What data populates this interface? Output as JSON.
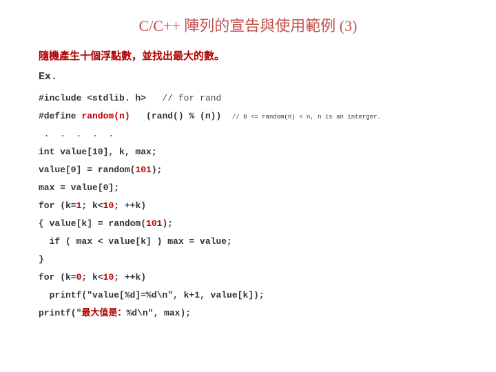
{
  "title": "C/C++ 陣列的宣告與使用範例 (3)",
  "subtitle": "隨機產生十個浮點數，並找出最大的數。",
  "ex_label": "Ex.",
  "code": {
    "l1a": "#include <stdlib. h>",
    "l1b": "// for rand",
    "l2a": "#define",
    "l2b": "random(n)",
    "l2c": "(rand() % (n))",
    "l2d": "// 0 <= random(n) < n, n is an interger.",
    "l3": " .  .  .  .  .",
    "l4": "int value[10], k, max;",
    "l5a": "value[0] = random(",
    "l5b": "101",
    "l5c": ");",
    "l6": "max = value[0];",
    "l7a": "for (k=",
    "l7b": "1",
    "l7c": "; k<",
    "l7d": "10",
    "l7e": "; ++k)",
    "l8a": "{ value[k] = random(",
    "l8b": "101",
    "l8c": ");",
    "l9": "  if ( max < value[k] ) max = value;",
    "l10": "}",
    "l11a": "for (k=",
    "l11b": "0",
    "l11c": "; k<",
    "l11d": "10",
    "l11e": "; ++k)",
    "l12": "  printf(\"value[%d]=%d\\n\", k+1, value[k]);",
    "l13a": "printf(\"",
    "l13b": "最大值是：",
    "l13c": "%d\\n\", max);"
  }
}
